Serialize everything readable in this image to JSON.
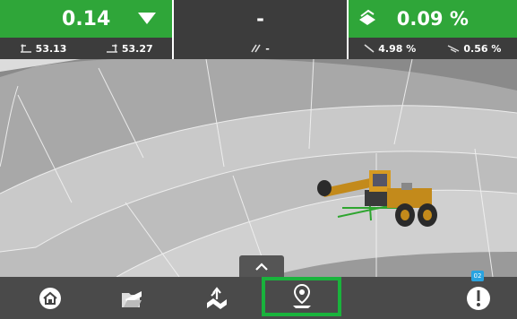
{
  "top_left": {
    "value": "0.14",
    "left_elev": "53.13",
    "right_elev": "53.27"
  },
  "top_middle": {
    "value": "-",
    "sub_value": "-"
  },
  "top_right": {
    "value": "0.09 %",
    "left_slope": "4.98 %",
    "right_slope": "0.56 %"
  },
  "bottom": {
    "alert_badge": "02"
  },
  "colors": {
    "accent": "#2fa639",
    "selection": "#19b33c",
    "dark": "#3c3c3c",
    "badge": "#29a3e0"
  },
  "icons": [
    "home-icon",
    "folder-icon",
    "surface-icon",
    "location-pin-icon",
    "alert-icon",
    "chevron-up-icon"
  ]
}
